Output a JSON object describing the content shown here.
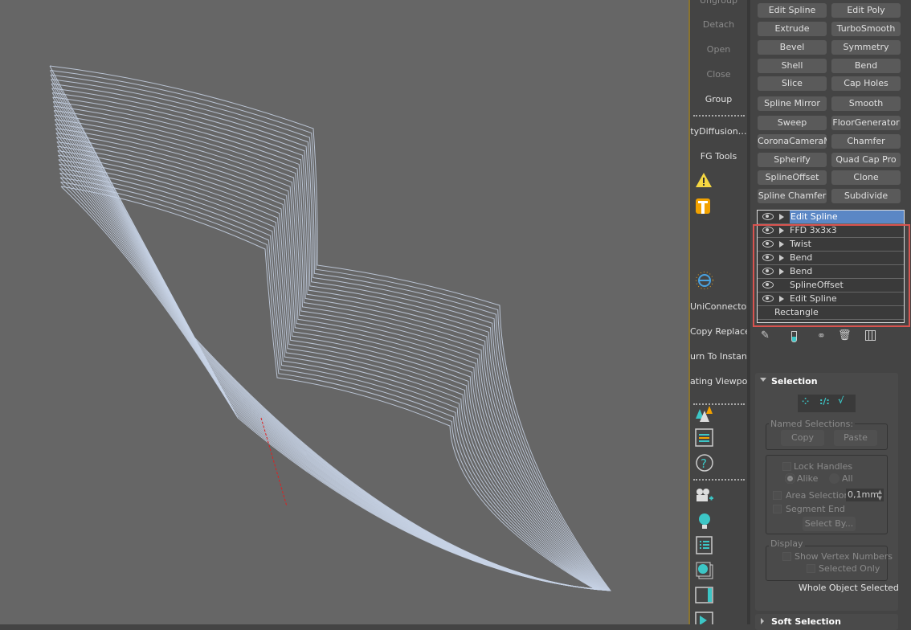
{
  "toolbar": {
    "items": [
      {
        "label": "Ungroup",
        "dim": true
      },
      {
        "label": "Detach",
        "dim": true
      },
      {
        "label": "Open",
        "dim": true
      },
      {
        "label": "Close",
        "dim": true
      },
      {
        "label": "Group",
        "dim": false
      },
      {
        "label": "tyDiffusion…",
        "dim": false
      },
      {
        "label": "FG Tools",
        "dim": false
      },
      {
        "label": "UniConnector",
        "dim": false
      },
      {
        "label": "Copy Replace",
        "dim": false
      },
      {
        "label": "urn To Instanc",
        "dim": false
      },
      {
        "label": "ating Viewport",
        "dim": false
      }
    ]
  },
  "modifier_buttons": [
    "Edit Spline",
    "Edit Poly",
    "Extrude",
    "TurboSmooth",
    "Bevel",
    "Symmetry",
    "Shell",
    "Bend",
    "Slice",
    "Cap Holes",
    "Spline Mirror",
    "Smooth",
    "Sweep",
    "FloorGenerator",
    "CoronaCameraMo",
    "Chamfer",
    "Spherify",
    "Quad Cap Pro",
    "SplineOffset",
    "Clone",
    "Spline Chamfer",
    "Subdivide"
  ],
  "stack": [
    {
      "label": "Edit Spline",
      "eye": true,
      "expand": true,
      "selected": true
    },
    {
      "label": "FFD 3x3x3",
      "eye": true,
      "expand": true
    },
    {
      "label": "Twist",
      "eye": true,
      "expand": true
    },
    {
      "label": "Bend",
      "eye": true,
      "expand": true
    },
    {
      "label": "Bend",
      "eye": true,
      "expand": true
    },
    {
      "label": "SplineOffset",
      "eye": true,
      "expand": false
    },
    {
      "label": "Edit Spline",
      "eye": true,
      "expand": true
    },
    {
      "label": "Rectangle",
      "eye": false,
      "expand": false
    }
  ],
  "colors": {
    "highlight_box": "#d9534f",
    "selected_row": "#5b87c5",
    "accent": "#3cc6c6"
  },
  "selection": {
    "title": "Selection",
    "named_selections": "Named Selections:",
    "copy": "Copy",
    "paste": "Paste",
    "lock_handles": "Lock Handles",
    "alike": "Alike",
    "all": "All",
    "area_selection": "Area Selection",
    "area_value": "0,1mm",
    "segment_end": "Segment End",
    "select_by": "Select By...",
    "display": "Display",
    "show_vertex_numbers": "Show Vertex Numbers",
    "selected_only": "Selected Only",
    "status": "Whole Object Selected"
  },
  "soft_selection": {
    "title": "Soft Selection"
  }
}
